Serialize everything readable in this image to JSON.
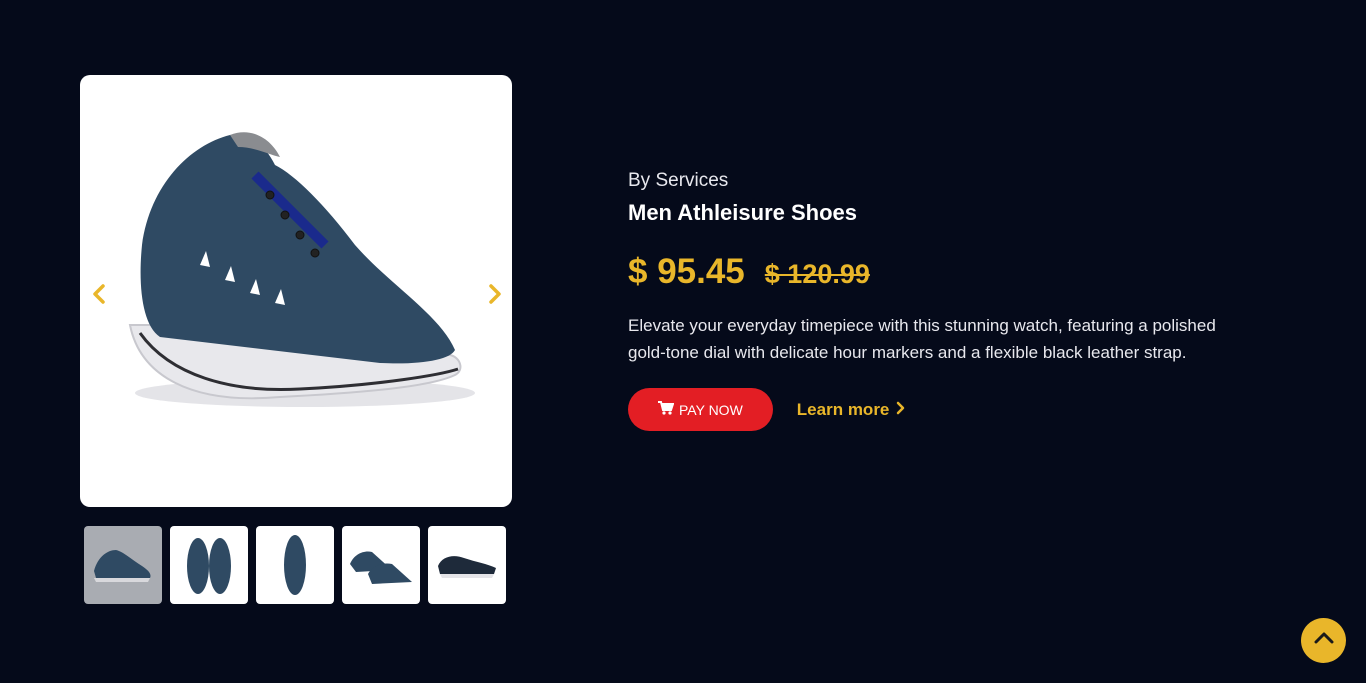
{
  "gallery": {
    "main_image_alt": "Men Athleisure Shoes",
    "prev_icon": "chevron-left-icon",
    "next_icon": "chevron-right-icon",
    "thumbnails": [
      {
        "view": "side",
        "active": true
      },
      {
        "view": "top-pair",
        "active": false
      },
      {
        "view": "top-single",
        "active": false
      },
      {
        "view": "angled-pair",
        "active": false
      },
      {
        "view": "profile",
        "active": false
      }
    ]
  },
  "product": {
    "brand": "By Services",
    "title": "Men Athleisure Shoes",
    "price": "$ 95.45",
    "old_price": "$ 120.99",
    "description": "Elevate your everyday timepiece with this stunning watch, featuring a polished gold-tone dial with delicate hour markers and a flexible black leather strap."
  },
  "actions": {
    "pay_label": "PAY NOW",
    "pay_icon": "cart-icon",
    "learn_label": "Learn more",
    "learn_icon": "chevron-right-icon"
  },
  "scroll_top_icon": "chevron-up-icon",
  "colors": {
    "background": "#050a1a",
    "accent": "#e9b62a",
    "pay_button": "#e31e24"
  }
}
